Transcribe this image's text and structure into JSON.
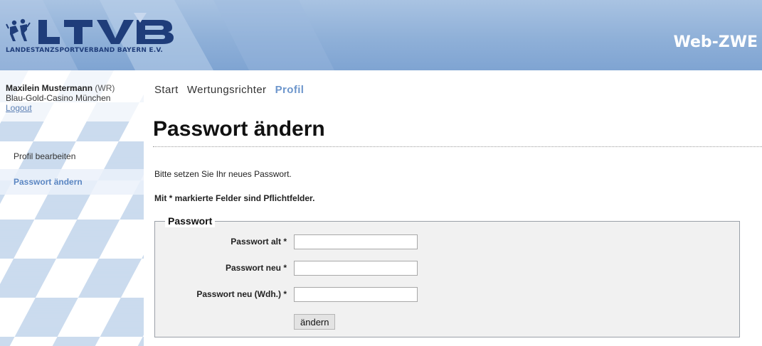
{
  "header": {
    "logo_text": "LTVB",
    "logo_subtitle": "LANDESTANZSPORTVERBAND BAYERN E.V.",
    "app_title": "Web-ZWE",
    "colors": {
      "header_blue": "#8fb0d8",
      "logo_blue": "#1f3d7a"
    }
  },
  "user": {
    "name": "Maxilein Mustermann",
    "role": "(WR)",
    "club": "Blau-Gold-Casino München",
    "logout_label": "Logout"
  },
  "sidebar": {
    "items": [
      {
        "label": "Profil bearbeiten",
        "active": false
      },
      {
        "label": "Passwort ändern",
        "active": true
      }
    ]
  },
  "top_nav": {
    "items": [
      {
        "label": "Start",
        "active": false
      },
      {
        "label": "Wertungsrichter",
        "active": false
      },
      {
        "label": "Profil",
        "active": true
      }
    ]
  },
  "main": {
    "title": "Passwort ändern",
    "intro": "Bitte setzen Sie Ihr neues Passwort.",
    "required_note": "Mit * markierte Felder sind Pflichtfelder.",
    "form": {
      "legend": "Passwort",
      "fields": [
        {
          "label": "Passwort alt *",
          "value": ""
        },
        {
          "label": "Passwort neu *",
          "value": ""
        },
        {
          "label": "Passwort neu (Wdh.) *",
          "value": ""
        }
      ],
      "submit_label": "ändern"
    }
  }
}
